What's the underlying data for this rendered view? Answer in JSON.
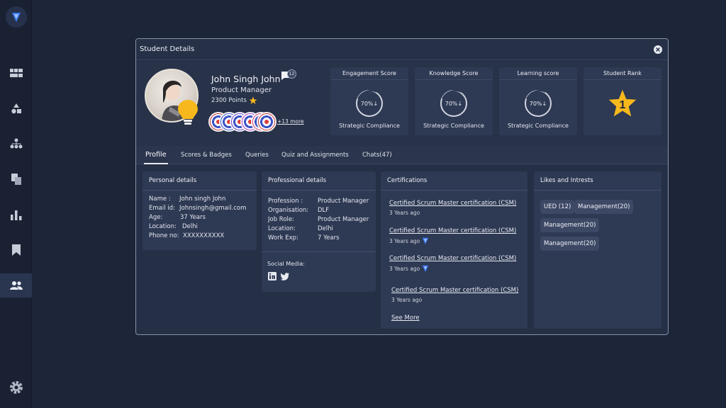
{
  "dialog": {
    "title": "Student Details"
  },
  "profile": {
    "name": "John Singh John",
    "role": "Product Manager",
    "points": "2300 Points",
    "chat_count": "12",
    "more_badges": "+13 more"
  },
  "scores": [
    {
      "title": "Engagement Score",
      "value": "70%↓",
      "subtitle": "Strategic Compliance"
    },
    {
      "title": "Knowledge Score",
      "value": "70%↓",
      "subtitle": "Strategic Compliance"
    },
    {
      "title": "Learning score",
      "value": "70%↓",
      "subtitle": "Strategic Compliance"
    }
  ],
  "rank": {
    "title": "Student Rank",
    "value": "1"
  },
  "tabs": [
    "Profile",
    "Scores & Badges",
    "Queries",
    "Quiz and Assignments",
    "Chats(47)"
  ],
  "personal": {
    "title": "Personal details",
    "rows": [
      {
        "label": "Name :",
        "value": "John singh John"
      },
      {
        "label": "Email id:",
        "value": "Johnsingh@gmail.com"
      },
      {
        "label": "Age:",
        "value": "37 Years"
      },
      {
        "label": "Location:",
        "value": "Delhi"
      },
      {
        "label": "Phone no:",
        "value": "XXXXXXXXXX"
      }
    ]
  },
  "professional": {
    "title": "Professional details",
    "rows": [
      {
        "label": "Profession :",
        "value": "Product Manager"
      },
      {
        "label": "Organisation:",
        "value": "DLF"
      },
      {
        "label": "Job Role:",
        "value": "Product Manager"
      },
      {
        "label": "Location:",
        "value": "Delhi"
      },
      {
        "label": "Work Exp:",
        "value": "7 Years"
      }
    ],
    "social_label": "Social Media:"
  },
  "certifications": {
    "title": "Certifications",
    "items": [
      {
        "name": "Certified Scrum Master certification (CSM)",
        "time": "3 Years ago"
      },
      {
        "name": "Certified Scrum Master certification (CSM)",
        "time": "3 Years ago"
      },
      {
        "name": "Certified Scrum Master certification (CSM)",
        "time": "3 Years ago"
      },
      {
        "name": "Certified Scrum Master certification (CSM)",
        "time": "3 Years ago"
      }
    ],
    "see_more": "See More"
  },
  "likes": {
    "title": "Likes and Intrests",
    "chips": [
      "UED (12)",
      "Management(20)",
      "Management(20)",
      "Management(20)"
    ]
  },
  "colors": {
    "background": "#1d2538",
    "card": "#2e3953",
    "star": "#f6b81c"
  }
}
